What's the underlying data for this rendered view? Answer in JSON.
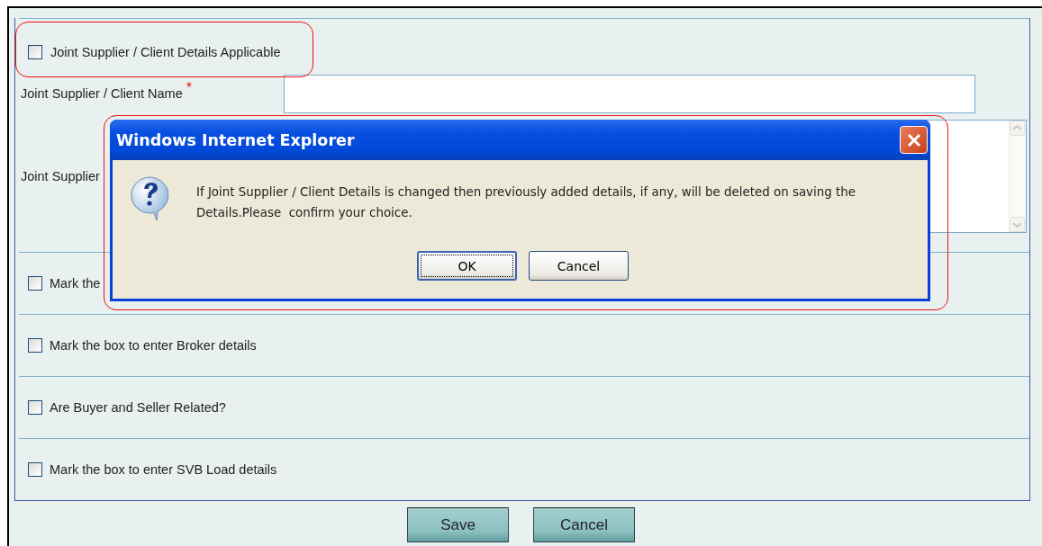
{
  "joint_section": {
    "applicable": {
      "label": "Joint Supplier / Client Details Applicable",
      "checked": false
    },
    "name_field": {
      "label": "Joint Supplier / Client Name",
      "required_mark": "*"
    },
    "address_field": {
      "label": "Joint Supplier"
    }
  },
  "checkbox_rows": [
    {
      "label": "Mark the",
      "checked": false
    },
    {
      "label": "Mark the box to enter Broker details",
      "checked": false
    },
    {
      "label": "Are Buyer and Seller Related?",
      "checked": false
    },
    {
      "label": "Mark the box to enter SVB Load details",
      "checked": false
    }
  ],
  "dialog": {
    "title": "Windows Internet Explorer",
    "message": "If Joint Supplier / Client Details is changed then previously added details, if any, will be deleted on saving the Details.Please  confirm your choice.",
    "buttons": [
      {
        "label": "OK",
        "focused": true
      },
      {
        "label": "Cancel",
        "focused": false
      }
    ]
  },
  "buttons": [
    "Save",
    "Cancel"
  ]
}
